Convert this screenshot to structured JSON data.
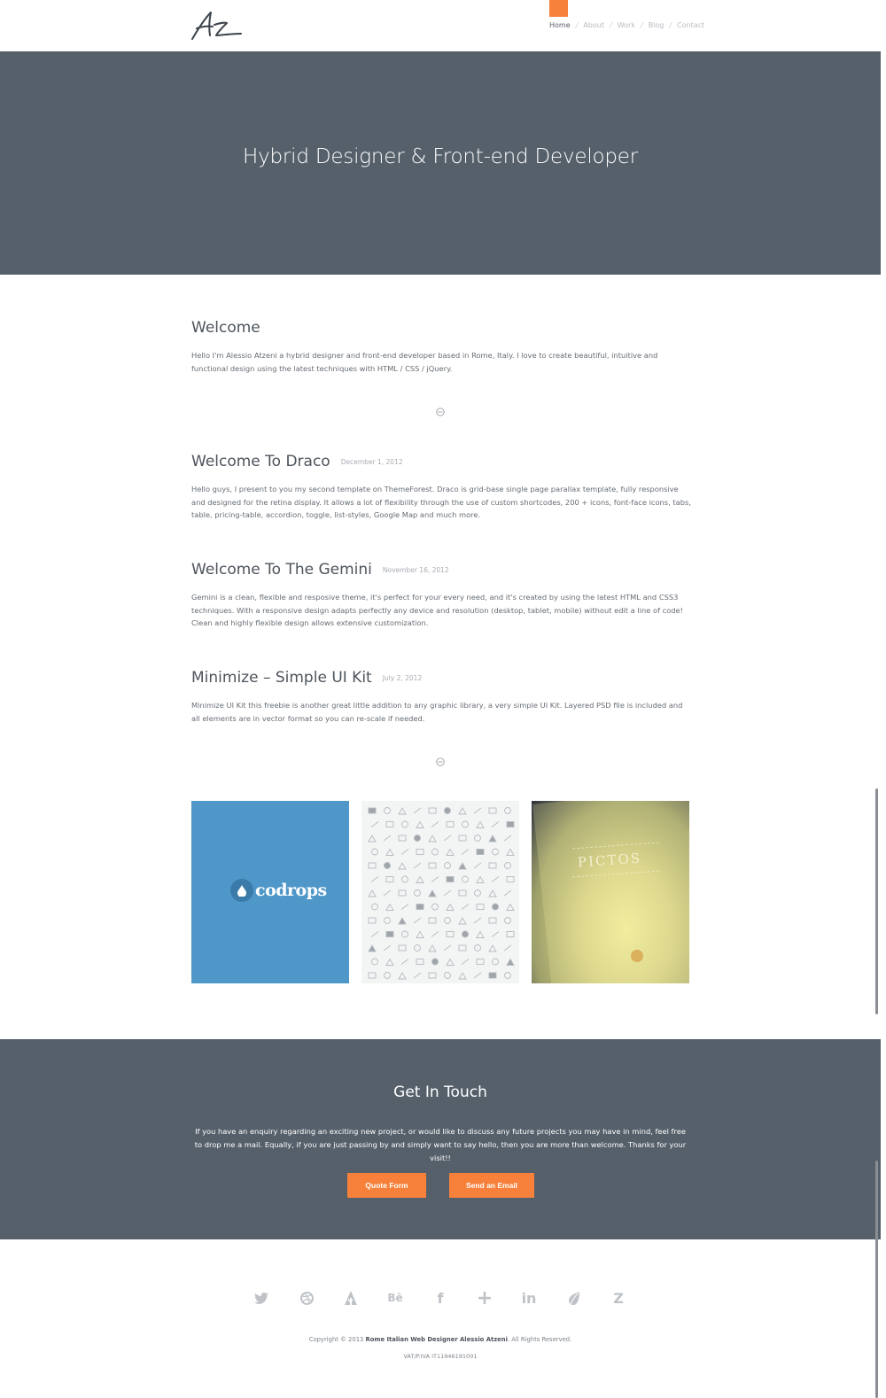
{
  "header": {
    "logo_text": "Az",
    "nav": [
      {
        "label": "Home"
      },
      {
        "label": "About"
      },
      {
        "label": "Work"
      },
      {
        "label": "Blog"
      },
      {
        "label": "Contact"
      }
    ],
    "separator": "/"
  },
  "hero": {
    "title": "Hybrid Designer & Front-end Developer"
  },
  "welcome": {
    "title": "Welcome",
    "text": "Hello I'm Alessio Atzeni a hybrid designer and front-end developer based in Rome, Italy. I love to create beautiful, intuitive and functional design using the latest techniques with HTML / CSS / jQuery."
  },
  "posts": [
    {
      "title": "Welcome To Draco",
      "date": "December 1, 2012",
      "text": "Hello guys, I present to you my second template on ThemeForest. Draco is grid-base single page parallax template, fully responsive and designed for the retina display. It allows a lot of flexibility through the use of custom shortcodes, 200 + icons, font-face icons, tabs, table, pricing-table, accordion, toggle, list-styles, Google Map and much more."
    },
    {
      "title": "Welcome To The Gemini",
      "date": "November 16, 2012",
      "text": "Gemini is a clean, flexible and resposive theme, it's perfect for your every need, and it's created by using the latest HTML and CSS3 techniques. With a responsive design adapts perfectly any device and resolution (desktop, tablet, mobile) without edit a line of code! Clean and highly flexible design allows extensive customization."
    },
    {
      "title": "Minimize – Simple UI Kit",
      "date": "July 2, 2012",
      "text": "Minimize UI Kit this freebie is another great little addition to any graphic library, a very simple UI Kit. Layered PSD file is included and all elements are in vector format so you can re-scale if needed."
    }
  ],
  "gallery": {
    "codrops_label": "codrops",
    "pictos_label": "PICTOS"
  },
  "contact": {
    "title": "Get In Touch",
    "text": "If you have an enquiry regarding an exciting new project, or would like to discuss any future projects you may have in mind, feel free to drop me a mail. Equally, if you are just passing by and simply want to say hello, then you are more than welcome. Thanks for your visit!!",
    "quote_label": "Quote Form",
    "email_label": "Send an Email"
  },
  "social": [
    {
      "icon": "twitter-icon",
      "glyph": "🐦"
    },
    {
      "icon": "dribbble-icon",
      "glyph": "◎"
    },
    {
      "icon": "forrst-icon",
      "glyph": "▲"
    },
    {
      "icon": "behance-icon",
      "glyph": "Bē"
    },
    {
      "icon": "facebook-icon",
      "glyph": "f"
    },
    {
      "icon": "google-plus-icon",
      "glyph": "+"
    },
    {
      "icon": "linkedin-icon",
      "glyph": "in"
    },
    {
      "icon": "envato-icon",
      "glyph": "❦"
    },
    {
      "icon": "zerply-icon",
      "glyph": "Z"
    }
  ],
  "footer": {
    "copyright_prefix": "Copyright © 2013 ",
    "copyright_bold": "Rome Italian Web Designer Alessio Atzeni",
    "copyright_suffix": ". All Rights Reserved.",
    "vat": "VAT/P.IVA IT11946191001"
  },
  "colors": {
    "accent": "#f7813b",
    "slate": "#56606b"
  }
}
